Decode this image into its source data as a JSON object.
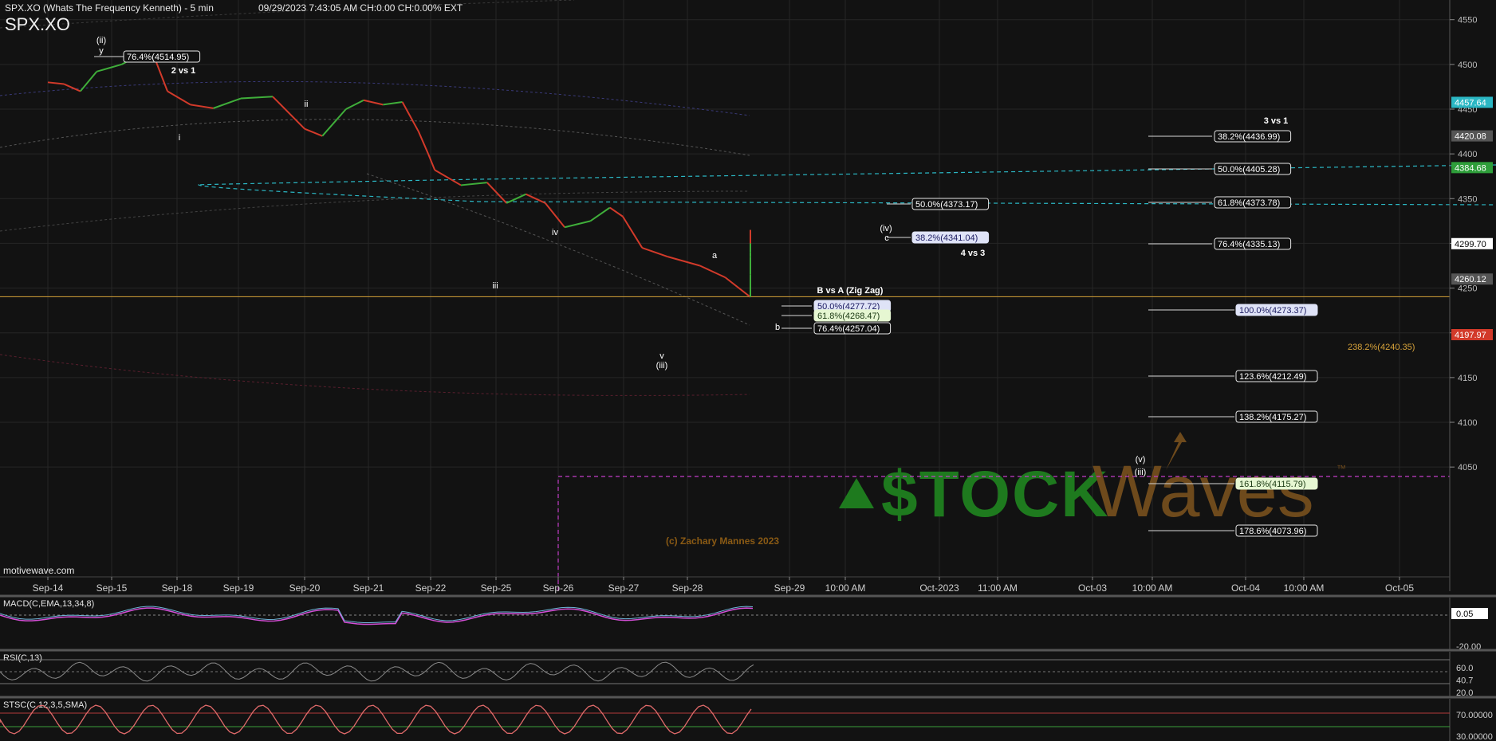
{
  "header": {
    "title": "SPX.XO (Whats The Frequency Kenneth) - 5 min",
    "info": "09/29/2023 7:43:05 AM  CH:0.00  CH:0.00%  EXT",
    "symbol": "SPX.XO"
  },
  "footer": {
    "brand": "motivewave.com",
    "copyright": "(c) Zachary Mannes 2023"
  },
  "watermark": {
    "left": "$TOCK",
    "right": "Waves",
    "tm": "™"
  },
  "colors": {
    "background": "#121212",
    "grid": "#262626",
    "up": "#3fae3a",
    "down": "#d23a2a",
    "cyan_channel": "#2bb7c4",
    "orange_level": "#d6a23a",
    "magenta": "#c23ec8",
    "macd": "#d54fd8",
    "macd_hist": "#6fb4d8",
    "watermark_green": "#1e7a1e",
    "watermark_brown": "#6e4a1c"
  },
  "chart_data": {
    "type": "line",
    "title": "SPX.XO (Whats The Frequency Kenneth) - 5 min",
    "x_ticks": [
      "Sep-14",
      "Sep-15",
      "Sep-18",
      "Sep-19",
      "Sep-20",
      "Sep-21",
      "Sep-22",
      "Sep-25",
      "Sep-26",
      "Sep-27",
      "Sep-28",
      "Sep-29",
      "10:00 AM",
      "Oct-2023",
      "11:00 AM",
      "Oct-03",
      "10:00 AM",
      "Oct-04",
      "10:00 AM",
      "Oct-05"
    ],
    "y_ticks": [
      4050,
      4100,
      4150,
      4200,
      4250,
      4300,
      4350,
      4400,
      4450,
      4500,
      4550
    ],
    "ylim": [
      4035,
      4572
    ],
    "price_axis_labels": [
      {
        "value": 4457.64,
        "label": "4457.64",
        "color": "#2bb7c4"
      },
      {
        "value": 4420.08,
        "label": "4420.08",
        "color": "#555555"
      },
      {
        "value": 4384.68,
        "label": "4384.68",
        "color": "#2e9e3a"
      },
      {
        "value": 4299.7,
        "label": "4299.70",
        "color": "#ffffff"
      },
      {
        "value": 4260.12,
        "label": "4260.12",
        "color": "#555555"
      },
      {
        "value": 4197.97,
        "label": "4197.97",
        "color": "#d23a2a"
      }
    ],
    "price_path": [
      {
        "x": 0.0,
        "y": 4480
      },
      {
        "x": 0.3,
        "y": 4478
      },
      {
        "x": 0.6,
        "y": 4470
      },
      {
        "x": 0.9,
        "y": 4492
      },
      {
        "x": 1.3,
        "y": 4500
      },
      {
        "x": 1.6,
        "y": 4512
      },
      {
        "x": 1.8,
        "y": 4508
      },
      {
        "x": 2.0,
        "y": 4470
      },
      {
        "x": 2.4,
        "y": 4455
      },
      {
        "x": 2.8,
        "y": 4451
      },
      {
        "x": 3.2,
        "y": 4462
      },
      {
        "x": 3.6,
        "y": 4464
      },
      {
        "x": 4.0,
        "y": 4428
      },
      {
        "x": 4.3,
        "y": 4420
      },
      {
        "x": 4.7,
        "y": 4450
      },
      {
        "x": 5.0,
        "y": 4460
      },
      {
        "x": 5.3,
        "y": 4455
      },
      {
        "x": 5.6,
        "y": 4458
      },
      {
        "x": 5.85,
        "y": 4425
      },
      {
        "x": 6.0,
        "y": 4400
      },
      {
        "x": 6.1,
        "y": 4382
      },
      {
        "x": 6.5,
        "y": 4365
      },
      {
        "x": 6.9,
        "y": 4368
      },
      {
        "x": 7.2,
        "y": 4345
      },
      {
        "x": 7.5,
        "y": 4355
      },
      {
        "x": 7.8,
        "y": 4345
      },
      {
        "x": 8.1,
        "y": 4318
      },
      {
        "x": 8.5,
        "y": 4325
      },
      {
        "x": 8.8,
        "y": 4340
      },
      {
        "x": 9.0,
        "y": 4330
      },
      {
        "x": 9.3,
        "y": 4295
      },
      {
        "x": 9.7,
        "y": 4285
      },
      {
        "x": 10.2,
        "y": 4275
      },
      {
        "x": 10.6,
        "y": 4262
      },
      {
        "x": 11.1,
        "y": 4240
      },
      {
        "x": 11.4,
        "y": 4265
      },
      {
        "x": 11.7,
        "y": 4285
      },
      {
        "x": 12.1,
        "y": 4290
      },
      {
        "x": 12.4,
        "y": 4310
      },
      {
        "x": 12.7,
        "y": 4315
      },
      {
        "x": 13.0,
        "y": 4295
      },
      {
        "x": 13.3,
        "y": 4300
      },
      {
        "x": 13.5,
        "y": 4310
      },
      {
        "x": 13.75,
        "y": 4300
      }
    ],
    "fib_labels": [
      {
        "text": "76.4%(4514.95)",
        "y": 4514.95,
        "box": "white"
      },
      {
        "text": "38.2%(4436.99)",
        "y": 4436.99,
        "box": "white"
      },
      {
        "text": "50.0%(4405.28)",
        "y": 4405.28,
        "box": "white"
      },
      {
        "text": "61.8%(4373.78)",
        "y": 4373.78,
        "box": "white"
      },
      {
        "text": "76.4%(4335.13)",
        "y": 4335.13,
        "box": "white"
      },
      {
        "text": "100.0%(4273.37)",
        "y": 4273.37,
        "box": "highlight"
      },
      {
        "text": "123.6%(4212.49)",
        "y": 4212.49,
        "box": "white"
      },
      {
        "text": "138.2%(4175.27)",
        "y": 4175.27,
        "box": "white"
      },
      {
        "text": "161.8%(4115.79)",
        "y": 4115.79,
        "box": "green"
      },
      {
        "text": "178.6%(4073.96)",
        "y": 4073.96,
        "box": "white"
      },
      {
        "text": "50.0%(4373.17)",
        "y": 4373.17,
        "box": "white"
      },
      {
        "text": "38.2%(4341.04)",
        "y": 4341.04,
        "box": "highlight"
      },
      {
        "text": "50.0%(4277.72)",
        "y": 4277.72,
        "box": "highlight"
      },
      {
        "text": "61.8%(4268.47)",
        "y": 4268.47,
        "box": "green"
      },
      {
        "text": "76.4%(4257.04)",
        "y": 4257.04,
        "box": "white"
      },
      {
        "text": "238.2%(4240.35)",
        "y": 4240.35,
        "box": "orange"
      }
    ],
    "wave_labels": [
      {
        "text": "(ii)"
      },
      {
        "text": "y"
      },
      {
        "text": "2 vs 1"
      },
      {
        "text": "i"
      },
      {
        "text": "ii"
      },
      {
        "text": "iii"
      },
      {
        "text": "iv"
      },
      {
        "text": "v"
      },
      {
        "text": "(iii)"
      },
      {
        "text": "a"
      },
      {
        "text": "b"
      },
      {
        "text": "(iv)"
      },
      {
        "text": "c"
      },
      {
        "text": "4 vs 3"
      },
      {
        "text": "3 vs 1"
      },
      {
        "text": "B vs A (Zig Zag)"
      },
      {
        "text": "(v)"
      },
      {
        "text": "(iii)"
      }
    ],
    "indicators": [
      {
        "name": "MACD(C,EMA,13,34,8)",
        "labels": [
          "0.05",
          "-20.00"
        ]
      },
      {
        "name": "RSI(C,13)",
        "labels": [
          "60.0",
          "40.7",
          "20.0"
        ]
      },
      {
        "name": "STSC(C,12,3,5,SMA)",
        "labels": [
          "70.00000",
          "30.00000"
        ]
      }
    ]
  }
}
